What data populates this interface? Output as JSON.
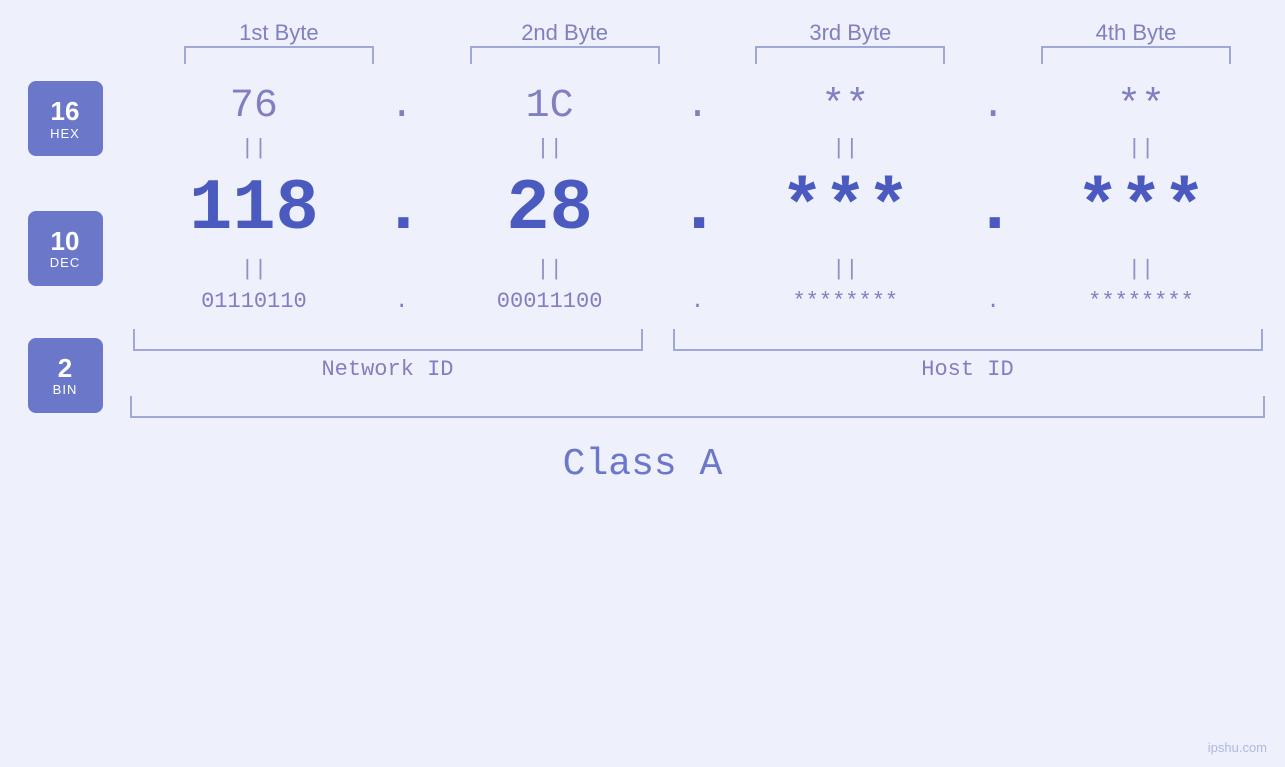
{
  "byteLabels": [
    "1st Byte",
    "2nd Byte",
    "3rd Byte",
    "4th Byte"
  ],
  "bases": [
    {
      "num": "16",
      "name": "HEX"
    },
    {
      "num": "10",
      "name": "DEC"
    },
    {
      "num": "2",
      "name": "BIN"
    }
  ],
  "hexValues": [
    "76",
    "1C",
    "**",
    "**"
  ],
  "decValues": [
    "118",
    "28",
    "***",
    "***"
  ],
  "binValues": [
    "01110110",
    "00011100",
    "********",
    "********"
  ],
  "networkIdLabel": "Network ID",
  "hostIdLabel": "Host ID",
  "classLabel": "Class A",
  "watermark": "ipshu.com",
  "dotSeparator": ".",
  "equalsSeparator": "||"
}
